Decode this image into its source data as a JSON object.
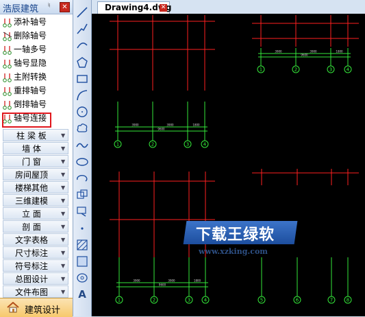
{
  "palette": {
    "title": "浩辰建筑",
    "commands": [
      {
        "label": "添补轴号",
        "icon": "axis-add-icon"
      },
      {
        "label": "删除轴号",
        "icon": "axis-delete-icon"
      },
      {
        "label": "一轴多号",
        "icon": "axis-multi-number-icon"
      },
      {
        "label": "轴号显隐",
        "icon": "axis-show-hide-icon"
      },
      {
        "label": "主附转换",
        "icon": "axis-main-sub-icon"
      },
      {
        "label": "重排轴号",
        "icon": "axis-renumber-icon"
      },
      {
        "label": "倒排轴号",
        "icon": "axis-reverse-icon"
      },
      {
        "label": "轴号连接",
        "icon": "axis-connect-icon",
        "selected": true
      }
    ],
    "categories": [
      "柱 梁 板",
      "墙    体",
      "门    窗",
      "房间屋顶",
      "楼梯其他",
      "三维建模",
      "立    面",
      "剖    面",
      "文字表格",
      "尺寸标注",
      "符号标注",
      "总图设计",
      "文件布图"
    ],
    "bottom_tab": "建筑设计"
  },
  "toolbar": {
    "tools": [
      "line-icon",
      "polyline-icon",
      "arc-polyline-icon",
      "polygon-icon",
      "rectangle-icon",
      "arc-icon",
      "circle-icon",
      "cloud-icon",
      "spline-icon",
      "ellipse-icon",
      "ellipse-arc-icon",
      "insert-block-icon",
      "make-block-icon",
      "point-icon",
      "hatch-icon",
      "region-icon",
      "table-icon",
      "text-icon"
    ],
    "text_tool_label": "A"
  },
  "tabs": [
    {
      "label": "Drawing4.dwg"
    }
  ],
  "drawing": {
    "colors": {
      "axis_line": "#ff2020",
      "axis_bubble": "#35e83a",
      "dim_line": "#35e83a",
      "background": "#000000"
    },
    "groups": [
      {
        "id": "tr",
        "axes": [
          "1",
          "2",
          "3",
          "4"
        ],
        "dims": [
          "3900",
          "3900",
          "1800"
        ],
        "total": "9600"
      },
      {
        "id": "tl",
        "axes": [
          "1",
          "2",
          "3",
          "4"
        ],
        "dims": [
          "3900",
          "3900",
          "1800"
        ],
        "total": "9600"
      },
      {
        "id": "bl",
        "axes": [
          "1",
          "2",
          "3",
          "4"
        ],
        "dims": [
          "3900",
          "3900",
          "1800"
        ],
        "total": "9600"
      },
      {
        "id": "br",
        "axes": [
          "5",
          "6",
          "7",
          "8"
        ]
      }
    ]
  },
  "watermark": {
    "title": "下载王绿软",
    "url": "www.xzking.com"
  }
}
